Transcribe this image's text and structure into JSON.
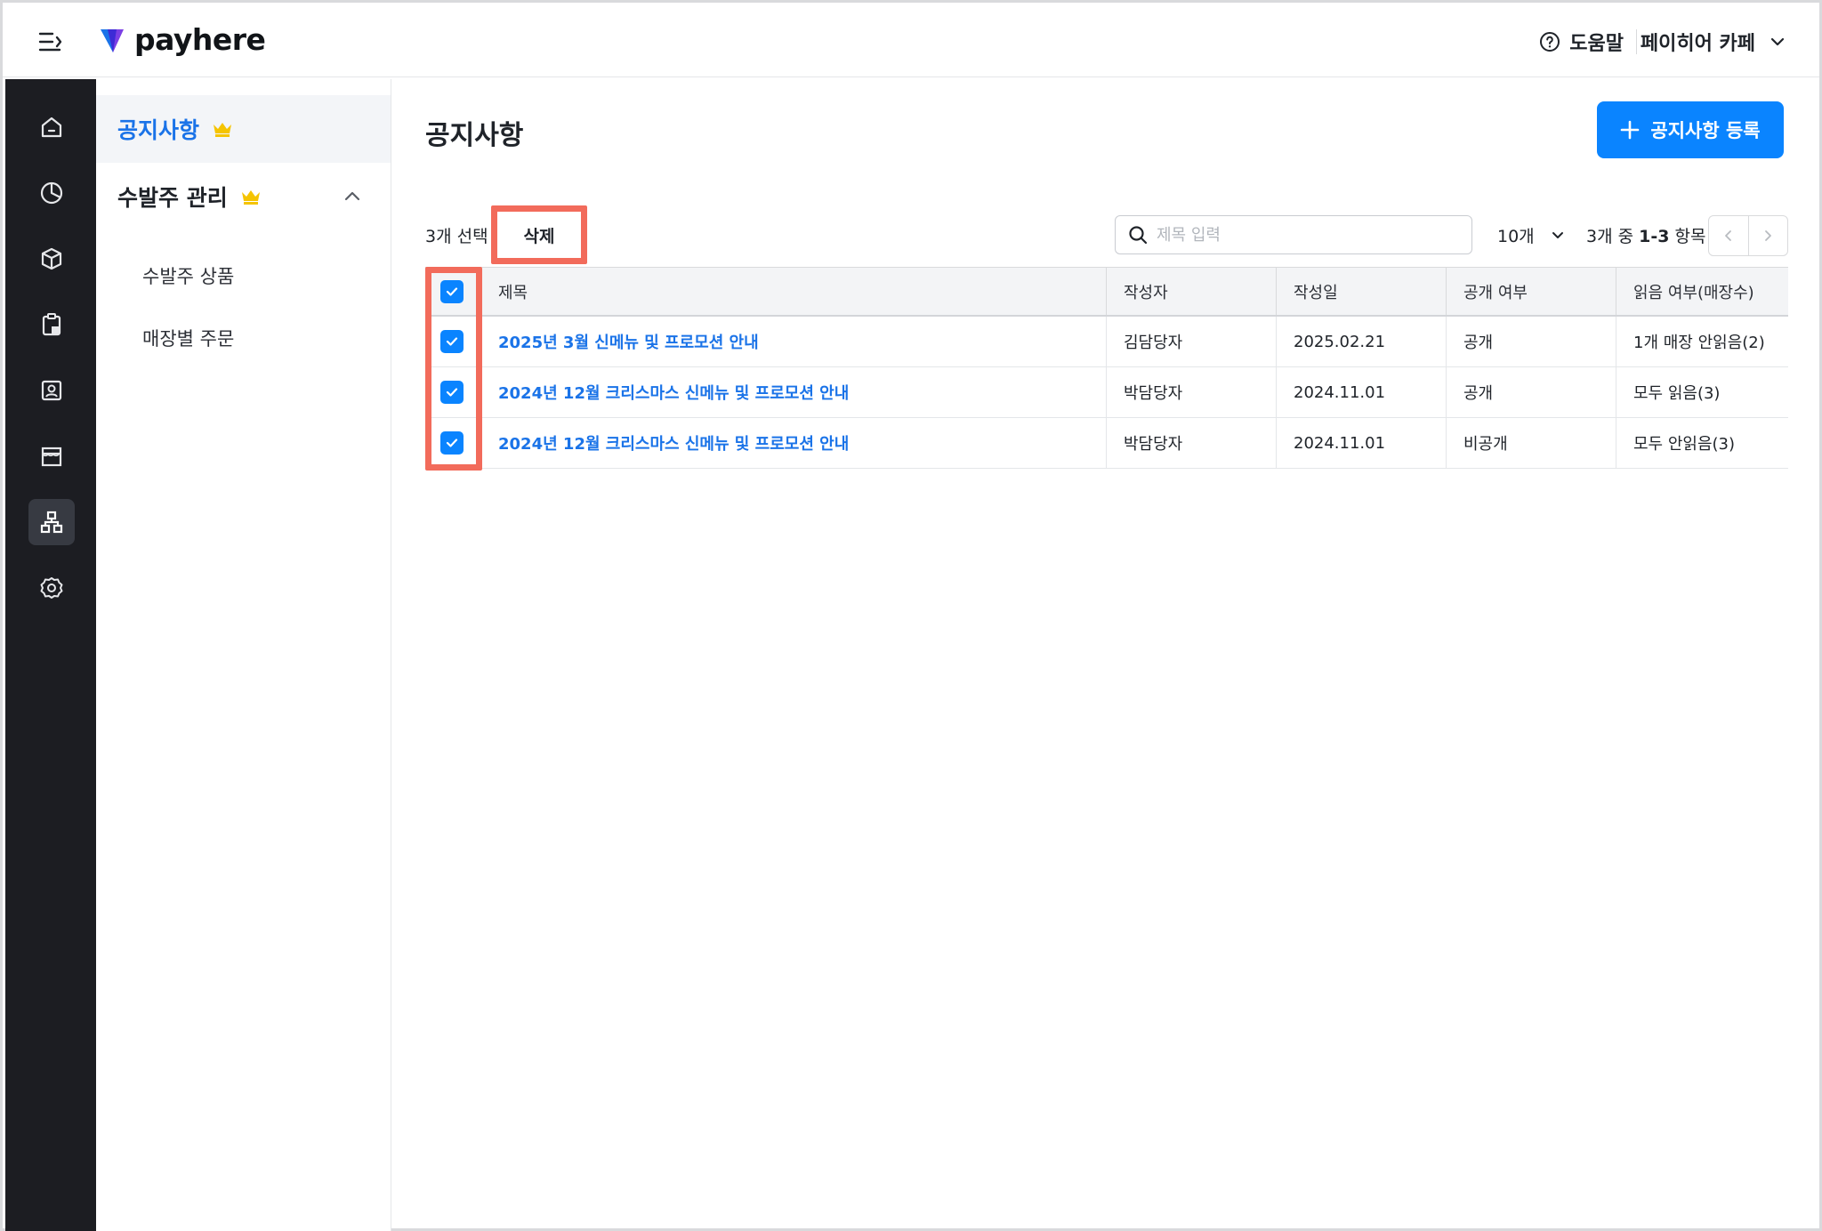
{
  "header": {
    "brand": "payhere",
    "help_label": "도움말",
    "store_name": "페이히어 카페"
  },
  "rail": {
    "items": [
      {
        "name": "home-icon",
        "active": false
      },
      {
        "name": "pie-chart-icon",
        "active": false
      },
      {
        "name": "box-icon",
        "active": false
      },
      {
        "name": "clipboard-icon",
        "active": false
      },
      {
        "name": "contact-card-icon",
        "active": false
      },
      {
        "name": "store-icon",
        "active": false
      },
      {
        "name": "org-chart-icon",
        "active": true
      },
      {
        "name": "settings-gear-icon",
        "active": false
      }
    ]
  },
  "subnav": {
    "notice": "공지사항",
    "order_mgmt": "수발주 관리",
    "order_products": "수발주 상품",
    "store_orders": "매장별 주문"
  },
  "main": {
    "title": "공지사항",
    "register_label": "공지사항 등록",
    "selected_count": "3개 선택",
    "delete_label": "삭제",
    "search_placeholder": "제목 입력",
    "page_size": "10개",
    "range_prefix": "3개 중 ",
    "range_bold": "1-3",
    "range_suffix": " 항목"
  },
  "table": {
    "columns": [
      "제목",
      "작성자",
      "작성일",
      "공개 여부",
      "읽음 여부(매장수)"
    ],
    "rows": [
      {
        "title": "2025년 3월 신메뉴 및 프로모션 안내",
        "author": "김담당자",
        "date": "2025.02.21",
        "visibility": "공개",
        "read_status": "1개 매장 안읽음(2)",
        "checked": true
      },
      {
        "title": "2024년 12월 크리스마스 신메뉴 및 프로모션 안내",
        "author": "박담당자",
        "date": "2024.11.01",
        "visibility": "공개",
        "read_status": "모두 읽음(3)",
        "checked": true
      },
      {
        "title": "2024년 12월 크리스마스 신메뉴 및 프로모션 안내",
        "author": "박담당자",
        "date": "2024.11.01",
        "visibility": "비공개",
        "read_status": "모두 안읽음(3)",
        "checked": true
      }
    ]
  },
  "colors": {
    "primary": "#0a84ff",
    "link": "#1a73e8",
    "highlight": "#f26b5b",
    "rail_bg": "#1c1d22",
    "crown": "#f5c400"
  }
}
